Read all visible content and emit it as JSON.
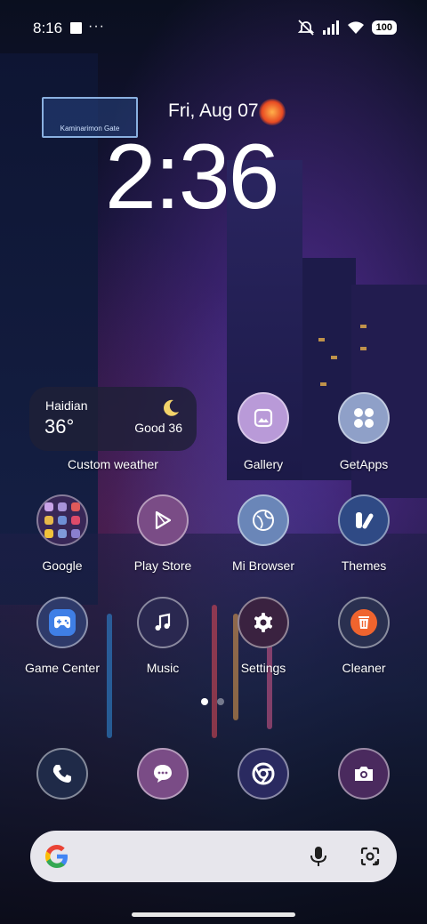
{
  "status_bar": {
    "time": "8:16",
    "more": "···",
    "battery": "100"
  },
  "lockclock": {
    "date": "Fri, Aug 07",
    "time": "2:36"
  },
  "background": {
    "sign_text": "Kaminarimon Gate"
  },
  "weather_widget": {
    "city": "Haidian",
    "temperature": "36°",
    "air_quality": "Good 36",
    "label": "Custom weather"
  },
  "apps": {
    "gallery": "Gallery",
    "getapps": "GetApps",
    "google": "Google",
    "play_store": "Play Store",
    "mi_browser": "Mi Browser",
    "themes": "Themes",
    "game_center": "Game Center",
    "music": "Music",
    "settings": "Settings",
    "cleaner": "Cleaner"
  },
  "dock": [
    "phone-icon",
    "messaging-icon",
    "chrome-icon",
    "camera-icon"
  ],
  "page_indicator": {
    "pages": 2,
    "current": 1
  },
  "colors": {
    "gallery_bg": "#b99ad8",
    "getapps_bg": "#8fa0c8",
    "play_store_bg": "#7a4c86",
    "mi_browser_bg": "#6a86b8",
    "themes_bg": "#2f4a85",
    "game_center_accent": "#3f7fe6",
    "cleaner_accent": "#f0642e",
    "search_bar_bg": "#e7e6ec"
  }
}
